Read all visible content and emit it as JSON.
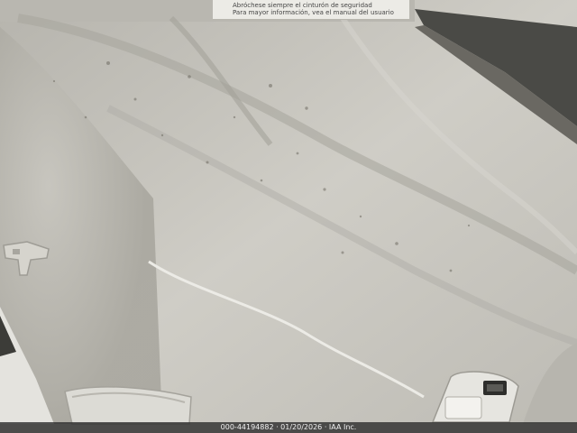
{
  "visor_label": {
    "line1": "Abróchese siempre el cinturón de seguridad",
    "line2": "Para mayor información, vea el manual del usuario"
  },
  "footer": {
    "caption": "000-44194882 · 01/20/2026 · IAA Inc."
  },
  "colors": {
    "headliner": "#c9c7c0",
    "shadow": "#8f8d86",
    "window_dark": "#4a4a46",
    "footer_bg": "#2a2a2a"
  }
}
